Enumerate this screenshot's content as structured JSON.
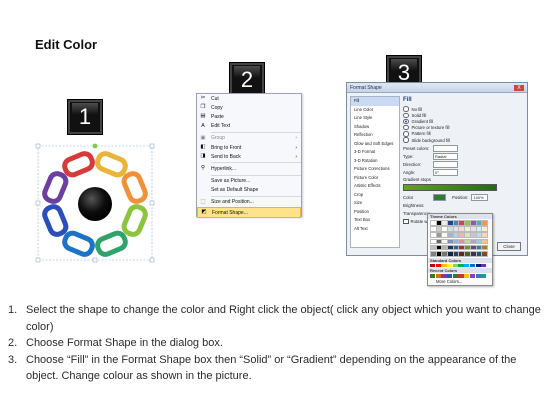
{
  "title": "Edit Color",
  "badges": [
    "1",
    "2",
    "3"
  ],
  "context_menu": {
    "items": [
      {
        "label": "Cut",
        "key": "cut",
        "disabled": false,
        "submenu": false
      },
      {
        "label": "Copy",
        "key": "copy",
        "disabled": false,
        "submenu": false
      },
      {
        "label": "Paste",
        "key": "paste",
        "disabled": false,
        "submenu": false
      },
      {
        "label": "Edit Text",
        "key": "edit-text",
        "disabled": false,
        "submenu": false
      },
      {
        "label": "Group",
        "key": "group",
        "disabled": true,
        "submenu": true
      },
      {
        "label": "Bring to Front",
        "key": "bring-to-front",
        "disabled": false,
        "submenu": true
      },
      {
        "label": "Send to Back",
        "key": "send-to-back",
        "disabled": false,
        "submenu": true
      },
      {
        "label": "Hyperlink...",
        "key": "hyperlink",
        "disabled": false,
        "submenu": false
      },
      {
        "label": "Save as Picture...",
        "key": "save-as-picture",
        "disabled": false,
        "submenu": false
      },
      {
        "label": "Set as Default Shape",
        "key": "set-default-shape",
        "disabled": false,
        "submenu": false
      },
      {
        "label": "Size and Position...",
        "key": "size-and-position",
        "disabled": false,
        "submenu": false
      },
      {
        "label": "Format Shape...",
        "key": "format-shape",
        "disabled": false,
        "submenu": false,
        "highlighted": true
      }
    ]
  },
  "dialog": {
    "title": "Format Shape",
    "close": "X",
    "categories": [
      "Fill",
      "Line Color",
      "Line Style",
      "Shadow",
      "Reflection",
      "Glow and Soft Edges",
      "3-D Format",
      "3-D Rotation",
      "Picture Corrections",
      "Picture Color",
      "Artistic Effects",
      "Crop",
      "Size",
      "Position",
      "Text Box",
      "Alt Text"
    ],
    "selected_category": "Fill",
    "fill_header": "Fill",
    "fill_options": [
      {
        "label": "No fill",
        "on": false
      },
      {
        "label": "Solid fill",
        "on": false
      },
      {
        "label": "Gradient fill",
        "on": true
      },
      {
        "label": "Picture or texture fill",
        "on": false
      },
      {
        "label": "Pattern fill",
        "on": false
      },
      {
        "label": "Slide background fill",
        "on": false
      }
    ],
    "fields": [
      {
        "label": "Preset colors:",
        "value": ""
      },
      {
        "label": "Type:",
        "value": "Radial"
      },
      {
        "label": "Direction:",
        "value": ""
      },
      {
        "label": "Angle:",
        "value": "0°"
      }
    ],
    "gradient_stops_label": "Gradient stops",
    "color_label": "Color",
    "position_label": "Position:",
    "position_value": "100%",
    "brightness_label": "Brightness:",
    "transparency_label": "Transparency:",
    "rotate_label": "Rotate with shape",
    "close_button": "Close"
  },
  "palette": {
    "theme_label": "Theme Colors",
    "standard_label": "Standard Colors",
    "recent_label": "Recent Colors",
    "more_label": "More Colors...",
    "theme_top": [
      "#ffffff",
      "#000000",
      "#eeece1",
      "#1f497d",
      "#4f81bd",
      "#c0504d",
      "#9bbb59",
      "#8064a2",
      "#4bacc6",
      "#f79646"
    ],
    "standard": [
      "#c00000",
      "#ff0000",
      "#ffc000",
      "#ffff00",
      "#92d050",
      "#00b050",
      "#00b0f0",
      "#0070c0",
      "#002060",
      "#7030a0"
    ],
    "recent": [
      "#3d7a1f",
      "#e36c09",
      "#7f3f98",
      "#1f5fa8",
      "#2e7d32",
      "#c0392b",
      "#f1c40f",
      "#8e44ad",
      "#2980b9",
      "#16a085"
    ]
  },
  "steps": [
    {
      "num": "1.",
      "text": "Select the shape to change the color and Right click the object( click any object which you want to change color)"
    },
    {
      "num": "2.",
      "text": "Choose Format Shape in the dialog box."
    },
    {
      "num": "3.",
      "text": "Choose “Fill” in the Format Shape box then “Solid” or “Gradient” depending on the appearance of the object. Change colour as shown in the picture."
    }
  ],
  "chain_colors": [
    "#e8b43a",
    "#f0913a",
    "#8cc43f",
    "#2fa36a",
    "#1d74c4",
    "#2b4fb8",
    "#6c3fa0",
    "#d63b3b"
  ]
}
